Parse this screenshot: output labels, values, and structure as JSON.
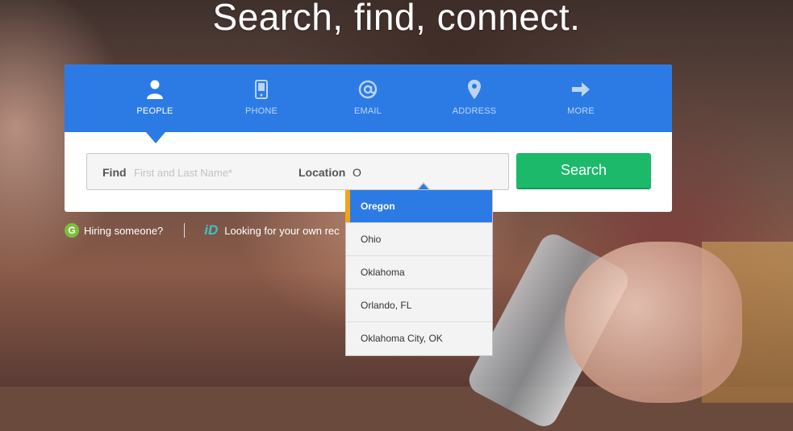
{
  "hero": {
    "headline": "Search, find, connect."
  },
  "tabs": [
    {
      "label": "PEOPLE",
      "icon": "person-icon",
      "active": true
    },
    {
      "label": "PHONE",
      "icon": "phone-icon",
      "active": false
    },
    {
      "label": "EMAIL",
      "icon": "at-sign-icon",
      "active": false
    },
    {
      "label": "ADDRESS",
      "icon": "location-pin-icon",
      "active": false
    },
    {
      "label": "MORE",
      "icon": "arrow-right-icon",
      "active": false
    }
  ],
  "search": {
    "find_label": "Find",
    "find_placeholder": "First and Last Name*",
    "find_value": "",
    "location_label": "Location",
    "location_value": "O",
    "button_label": "Search"
  },
  "links": {
    "hiring_badge": "G",
    "hiring": "Hiring someone?",
    "id_logo": "iD",
    "own_record": "Looking for your own rec"
  },
  "suggestions": [
    {
      "label": "Oregon",
      "active": true
    },
    {
      "label": "Ohio",
      "active": false
    },
    {
      "label": "Oklahoma",
      "active": false
    },
    {
      "label": "Orlando, FL",
      "active": false
    },
    {
      "label": "Oklahoma City, OK",
      "active": false
    }
  ],
  "colors": {
    "tab_bar": "#2c7be5",
    "search_button": "#1db96b",
    "active_suggestion": "#2c7be5",
    "suggestion_accent": "#f0a419"
  }
}
